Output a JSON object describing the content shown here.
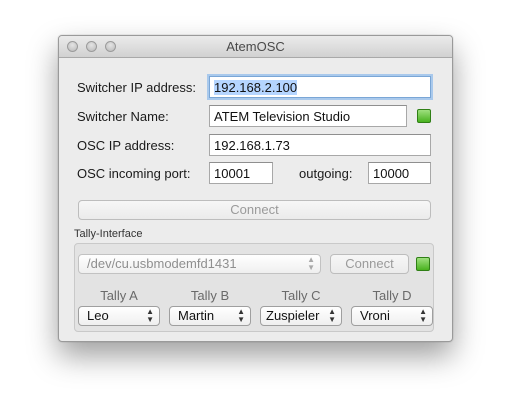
{
  "window": {
    "title": "AtemOSC"
  },
  "form": {
    "switcher_ip_label": "Switcher IP address:",
    "switcher_ip_value": "192.168.2.100",
    "switcher_name_label": "Switcher Name:",
    "switcher_name_value": "ATEM Television Studio",
    "osc_ip_label": "OSC IP address:",
    "osc_ip_value": "192.168.1.73",
    "osc_incoming_label": "OSC incoming port:",
    "osc_incoming_value": "10001",
    "outgoing_label": "outgoing:",
    "outgoing_value": "10000",
    "connect_label": "Connect",
    "status_color": "#4cb423"
  },
  "tally": {
    "section_label": "Tally-Interface",
    "device_value": "/dev/cu.usbmodemfd1431",
    "connect_label": "Connect",
    "status_color": "#4cb423",
    "columns": [
      {
        "header": "Tally A",
        "value": "Leo"
      },
      {
        "header": "Tally B",
        "value": "Martin"
      },
      {
        "header": "Tally C",
        "value": "Zuspieler"
      },
      {
        "header": "Tally D",
        "value": "Vroni"
      }
    ]
  }
}
